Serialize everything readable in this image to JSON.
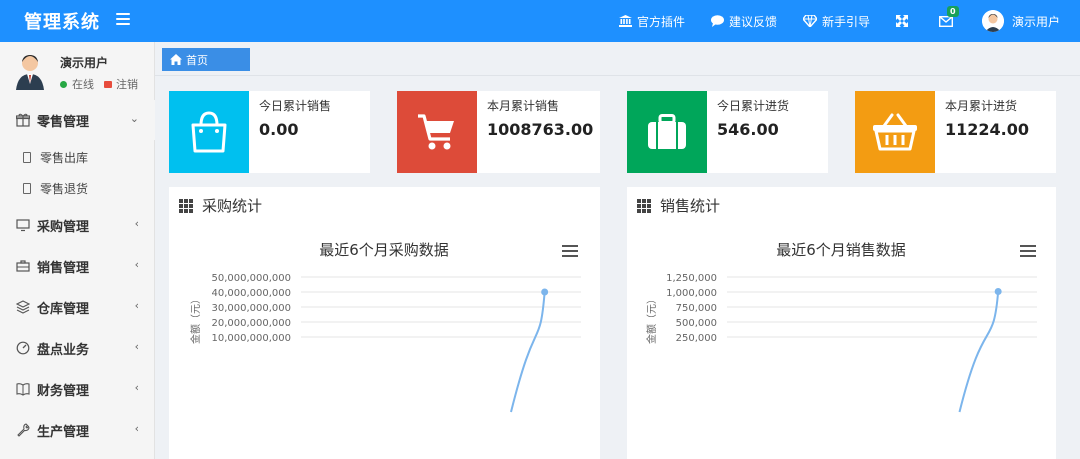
{
  "app": {
    "title": "管理系统"
  },
  "topnav": {
    "items": [
      {
        "label": "官方插件",
        "icon": "bank-icon"
      },
      {
        "label": "建议反馈",
        "icon": "comment-icon"
      },
      {
        "label": "新手引导",
        "icon": "diamond-icon"
      }
    ],
    "mail_badge": "0",
    "user_name": "演示用户"
  },
  "sidebar": {
    "user_name": "演示用户",
    "status": "在线",
    "logout": "注销",
    "menu": [
      {
        "label": "零售管理",
        "expanded": true,
        "children": [
          "零售出库",
          "零售退货"
        ]
      },
      {
        "label": "采购管理"
      },
      {
        "label": "销售管理"
      },
      {
        "label": "仓库管理"
      },
      {
        "label": "盘点业务"
      },
      {
        "label": "财务管理"
      },
      {
        "label": "生产管理"
      }
    ]
  },
  "tabs": {
    "home": "首页"
  },
  "stats": [
    {
      "label": "今日累计销售",
      "value": "0.00",
      "color": "#00c0ef",
      "icon": "shopping-bag-icon"
    },
    {
      "label": "本月累计销售",
      "value": "1008763.00",
      "color": "#dd4b39",
      "icon": "shopping-cart-icon"
    },
    {
      "label": "今日累计进货",
      "value": "546.00",
      "color": "#00a65a",
      "icon": "briefcase-icon"
    },
    {
      "label": "本月累计进货",
      "value": "11224.00",
      "color": "#f39c12",
      "icon": "basket-icon"
    }
  ],
  "panels": [
    {
      "title": "采购统计"
    },
    {
      "title": "销售统计"
    }
  ],
  "chart_data": [
    {
      "type": "line",
      "title": "最近6个月采购数据",
      "ylabel": "金额（元）",
      "ylim": [
        0,
        50000000000
      ],
      "yticks": [
        "10,000,000,000",
        "20,000,000,000",
        "30,000,000,000",
        "40,000,000,000",
        "50,000,000,000"
      ],
      "ytick_values": [
        10000000000,
        20000000000,
        30000000000,
        40000000000,
        50000000000
      ],
      "series": [
        {
          "values": [
            0,
            0,
            0,
            0,
            0,
            40000000000
          ]
        }
      ],
      "line_color": "#7cb5ec"
    },
    {
      "type": "line",
      "title": "最近6个月销售数据",
      "ylabel": "金额（元）",
      "ylim": [
        0,
        1250000
      ],
      "yticks": [
        "250,000",
        "500,000",
        "750,000",
        "1,000,000",
        "1,250,000"
      ],
      "ytick_values": [
        250000,
        500000,
        750000,
        1000000,
        1250000
      ],
      "series": [
        {
          "values": [
            0,
            0,
            0,
            0,
            0,
            1008763
          ]
        }
      ],
      "line_color": "#7cb5ec"
    }
  ]
}
